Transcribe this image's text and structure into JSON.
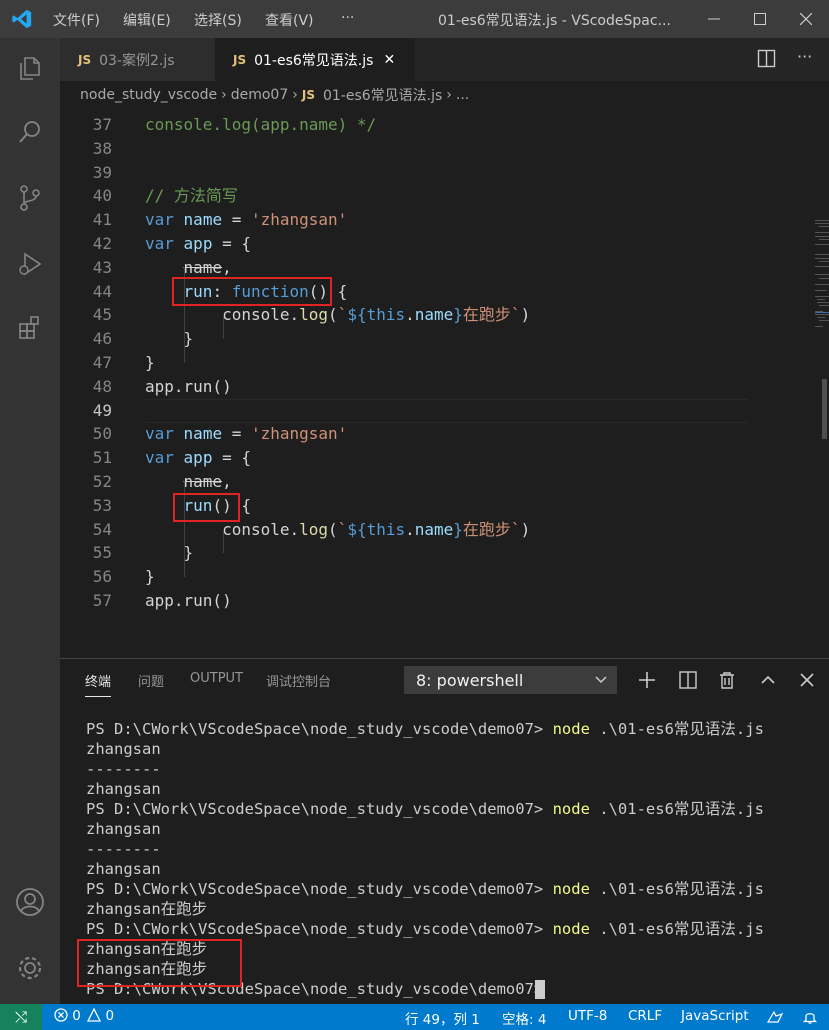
{
  "titlebar": {
    "menus": [
      "文件(F)",
      "编辑(E)",
      "选择(S)",
      "查看(V)",
      "···"
    ],
    "title": "01-es6常见语法.js - VScodeSpac..."
  },
  "tabs": [
    {
      "badge": "JS",
      "label": "03-案例2.js",
      "active": false
    },
    {
      "badge": "JS",
      "label": "01-es6常见语法.js",
      "active": true,
      "close": "✕"
    }
  ],
  "breadcrumb": [
    "node_study_vscode",
    "demo07",
    "JS",
    "01-es6常见语法.js",
    "..."
  ],
  "editor": {
    "lines": [
      {
        "n": "37",
        "text": "console.log(app.name) */"
      },
      {
        "n": "38",
        "text": ""
      },
      {
        "n": "39",
        "text": ""
      },
      {
        "n": "40",
        "text": "// 方法简写"
      },
      {
        "n": "41",
        "text": "var name = 'zhangsan'"
      },
      {
        "n": "42",
        "text": "var app = {"
      },
      {
        "n": "43",
        "text": "    name,"
      },
      {
        "n": "44",
        "text": "    run: function() {"
      },
      {
        "n": "45",
        "text": "        console.log(`${this.name}在跑步`)"
      },
      {
        "n": "46",
        "text": "    }"
      },
      {
        "n": "47",
        "text": "}"
      },
      {
        "n": "48",
        "text": "app.run()"
      },
      {
        "n": "49",
        "text": ""
      },
      {
        "n": "50",
        "text": "var name = 'zhangsan'"
      },
      {
        "n": "51",
        "text": "var app = {"
      },
      {
        "n": "52",
        "text": "    name,"
      },
      {
        "n": "53",
        "text": "    run() {"
      },
      {
        "n": "54",
        "text": "        console.log(`${this.name}在跑步`)"
      },
      {
        "n": "55",
        "text": "    }"
      },
      {
        "n": "56",
        "text": "}"
      },
      {
        "n": "57",
        "text": "app.run()"
      }
    ]
  },
  "panel": {
    "tabs": [
      "终端",
      "问题",
      "OUTPUT",
      "调试控制台"
    ],
    "terminal_select": "8: powershell",
    "terminal_lines": [
      {
        "prompt": "PS D:\\CWork\\VScodeSpace\\node_study_vscode\\demo07> ",
        "cmd": "node",
        "args": " .\\01-es6常见语法.js"
      },
      {
        "text": "zhangsan"
      },
      {
        "text": "--------"
      },
      {
        "text": "zhangsan"
      },
      {
        "prompt": "PS D:\\CWork\\VScodeSpace\\node_study_vscode\\demo07> ",
        "cmd": "node",
        "args": " .\\01-es6常见语法.js"
      },
      {
        "text": "zhangsan"
      },
      {
        "text": "--------"
      },
      {
        "text": "zhangsan"
      },
      {
        "prompt": "PS D:\\CWork\\VScodeSpace\\node_study_vscode\\demo07> ",
        "cmd": "node",
        "args": " .\\01-es6常见语法.js"
      },
      {
        "text": "zhangsan在跑步"
      },
      {
        "prompt": "PS D:\\CWork\\VScodeSpace\\node_study_vscode\\demo07> ",
        "cmd": "node",
        "args": " .\\01-es6常见语法.js"
      },
      {
        "text": "zhangsan在跑步"
      },
      {
        "text": "zhangsan在跑步"
      },
      {
        "prompt": "PS D:\\CWork\\VScodeSpace\\node_study_vscode\\demo07>",
        "cmd": "",
        "args": ""
      }
    ]
  },
  "statusbar": {
    "remote": "⤭",
    "errors": "0",
    "warnings": "0",
    "position": "行 49，列 1",
    "spaces": "空格: 4",
    "encoding": "UTF-8",
    "eol": "CRLF",
    "language": "JavaScript"
  },
  "colors": {
    "accent": "#007acc",
    "highlight_box": "#e02424"
  }
}
